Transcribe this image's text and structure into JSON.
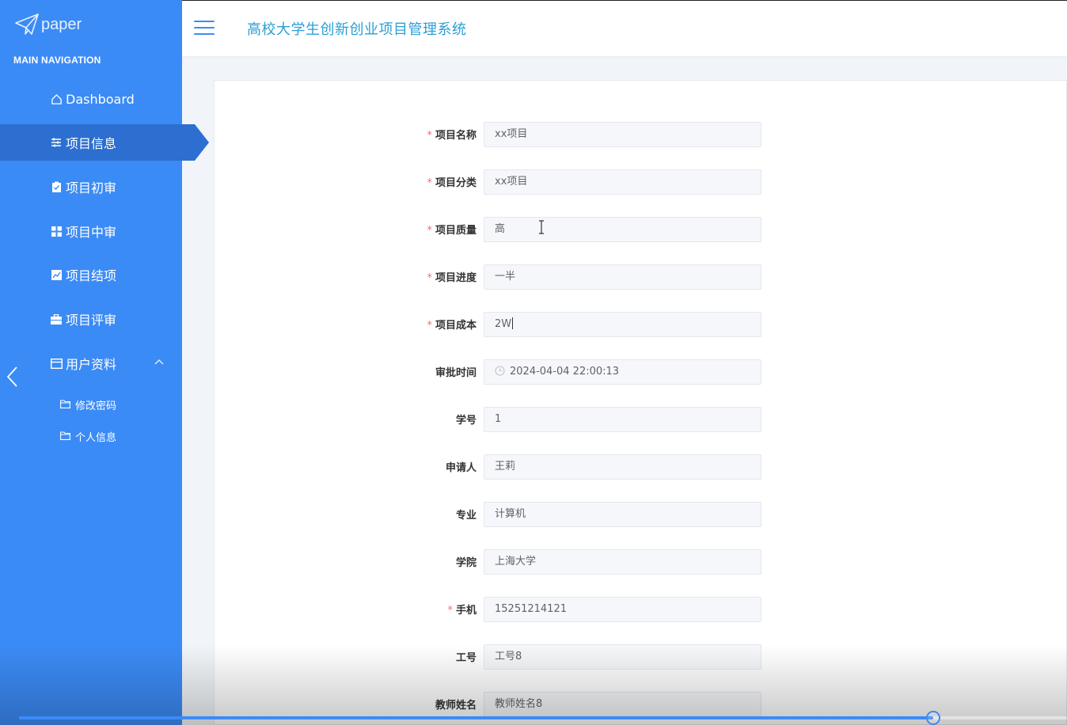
{
  "brand": {
    "logo_text": "paper"
  },
  "sidebar": {
    "header": "MAIN NAVIGATION",
    "items": [
      {
        "label": "Dashboard",
        "icon": "home-icon"
      },
      {
        "label": "项目信息",
        "icon": "sliders-icon",
        "active": true
      },
      {
        "label": "项目初审",
        "icon": "clipboard-icon"
      },
      {
        "label": "项目中审",
        "icon": "grid-icon"
      },
      {
        "label": "项目结项",
        "icon": "chart-icon"
      },
      {
        "label": "项目评审",
        "icon": "briefcase-icon"
      },
      {
        "label": "用户资料",
        "icon": "card-icon",
        "expanded": true
      }
    ],
    "subitems": [
      {
        "label": "修改密码",
        "icon": "folder-icon"
      },
      {
        "label": "个人信息",
        "icon": "folder-icon"
      }
    ]
  },
  "topbar": {
    "title": "高校大学生创新创业项目管理系统"
  },
  "form": {
    "fields": [
      {
        "label": "项目名称",
        "required": true,
        "value": "xx项目"
      },
      {
        "label": "项目分类",
        "required": true,
        "value": "xx项目"
      },
      {
        "label": "项目质量",
        "required": true,
        "value": "高"
      },
      {
        "label": "项目进度",
        "required": true,
        "value": "一半"
      },
      {
        "label": "项目成本",
        "required": true,
        "value": "2W"
      },
      {
        "label": "审批时间",
        "required": false,
        "value": "2024-04-04 22:00:13"
      },
      {
        "label": "学号",
        "required": false,
        "value": "1"
      },
      {
        "label": "申请人",
        "required": false,
        "value": "王莉"
      },
      {
        "label": "专业",
        "required": false,
        "value": "计算机"
      },
      {
        "label": "学院",
        "required": false,
        "value": "上海大学"
      },
      {
        "label": "手机",
        "required": true,
        "value": "15251214121"
      },
      {
        "label": "工号",
        "required": false,
        "value": "工号8"
      },
      {
        "label": "教师姓名",
        "required": false,
        "value": "教师姓名8"
      }
    ]
  },
  "player": {
    "progress": 0.872
  },
  "colors": {
    "sidebar": "#3b8bf6",
    "active": "#2c6fd1",
    "title": "#2a9fd6",
    "required": "#f56c6c"
  }
}
